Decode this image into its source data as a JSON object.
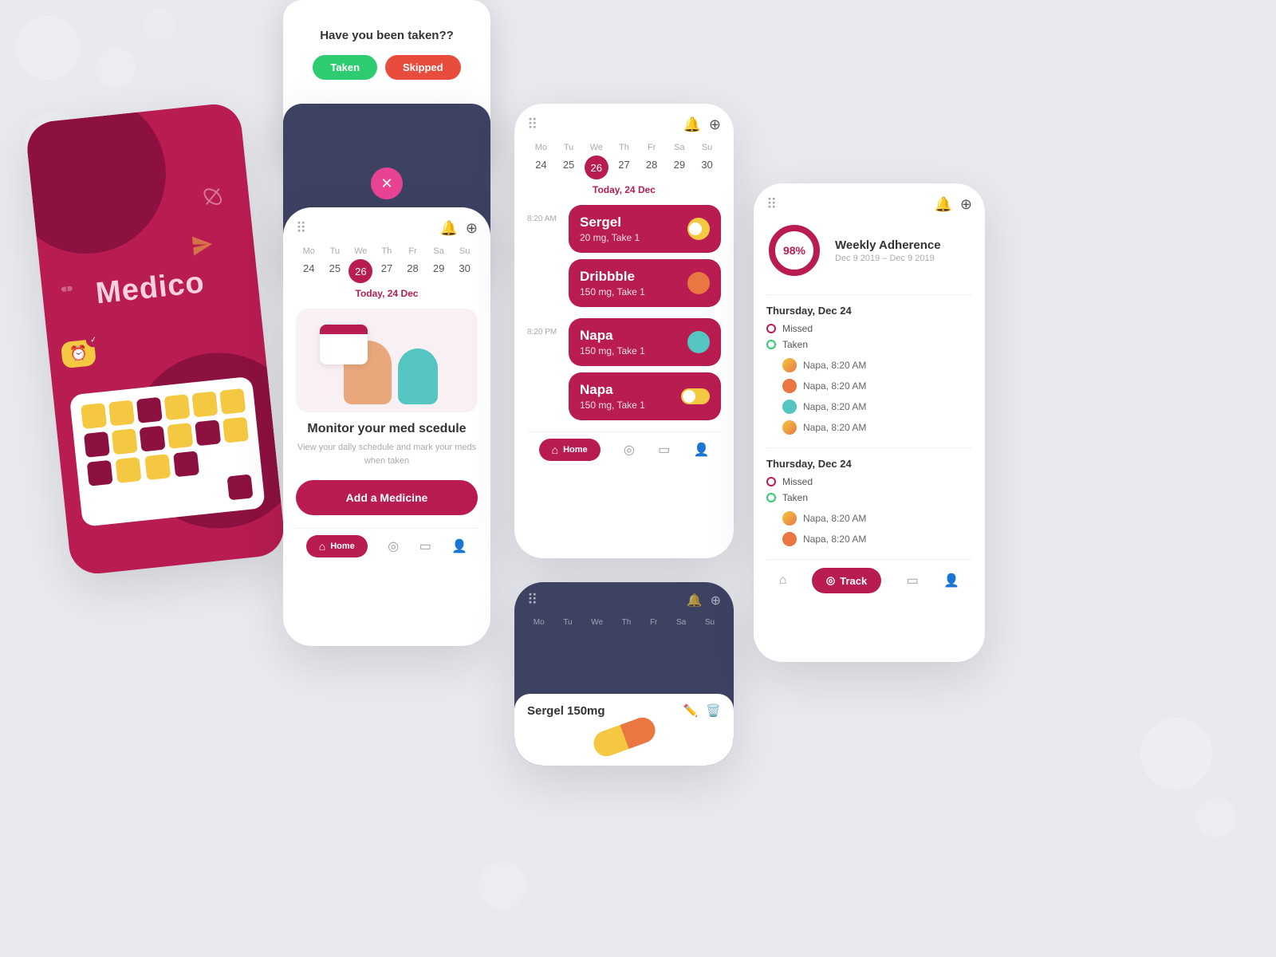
{
  "bg": {
    "color": "#e8eaf0"
  },
  "splash": {
    "title": "Medico"
  },
  "popup": {
    "title": "Have you been taken??",
    "btn_taken": "Taken",
    "btn_skipped": "Skipped"
  },
  "schedule": {
    "week_days": [
      "Mo",
      "Tu",
      "We",
      "Th",
      "Fr",
      "Sa",
      "Su"
    ],
    "week_dates": [
      "24",
      "25",
      "26",
      "27",
      "28",
      "29",
      "30"
    ],
    "active_date": "26",
    "today_label": "Today, 24 Dec",
    "monitor_title": "Monitor your med scedule",
    "monitor_sub": "View your daily schedule and mark your meds when taken",
    "add_btn": "Add a Medicine",
    "nav_home": "Home"
  },
  "meds_card": {
    "week_days": [
      "Mo",
      "Tu",
      "We",
      "Th",
      "Fr",
      "Sa",
      "Su"
    ],
    "week_dates": [
      "24",
      "25",
      "26",
      "27",
      "28",
      "29",
      "30"
    ],
    "active_date": "26",
    "today_label": "Today, 24 Dec",
    "time_morning": "8:20 AM",
    "time_evening": "8:20 PM",
    "medications": [
      {
        "name": "Sergel",
        "dose": "20 mg, Take 1",
        "dot": "yellow"
      },
      {
        "name": "Dribbble",
        "dose": "150 mg, Take 1",
        "dot": "orange"
      },
      {
        "name": "Napa",
        "dose": "150 mg, Take 1",
        "dot": "teal"
      },
      {
        "name": "Napa",
        "dose": "150 mg, Take 1",
        "dot": "yellow"
      }
    ],
    "nav_home": "Home"
  },
  "sergel": {
    "title": "Sergel 150mg"
  },
  "adherence": {
    "percent": "98%",
    "title": "Weekly Adherence",
    "date_range": "Dec 9 2019 – Dec 9 2019",
    "section1_date": "Thursday, Dec 24",
    "section2_date": "Thursday, Dec 24",
    "missed_label": "Missed",
    "taken_label": "Taken",
    "entries": [
      {
        "name": "Napa, 8:20 AM",
        "dot": "#f5c842"
      },
      {
        "name": "Napa, 8:20 AM",
        "dot": "#e87742"
      },
      {
        "name": "Napa, 8:20 AM",
        "dot": "#54c5c0"
      },
      {
        "name": "Napa, 8:20 AM",
        "dot": "#f5c842"
      }
    ],
    "entries2": [
      {
        "name": "Napa, 8:20 AM",
        "dot": "#f5c842"
      },
      {
        "name": "Napa, 8:20 AM",
        "dot": "#e87742"
      }
    ],
    "track_label": "Track"
  }
}
